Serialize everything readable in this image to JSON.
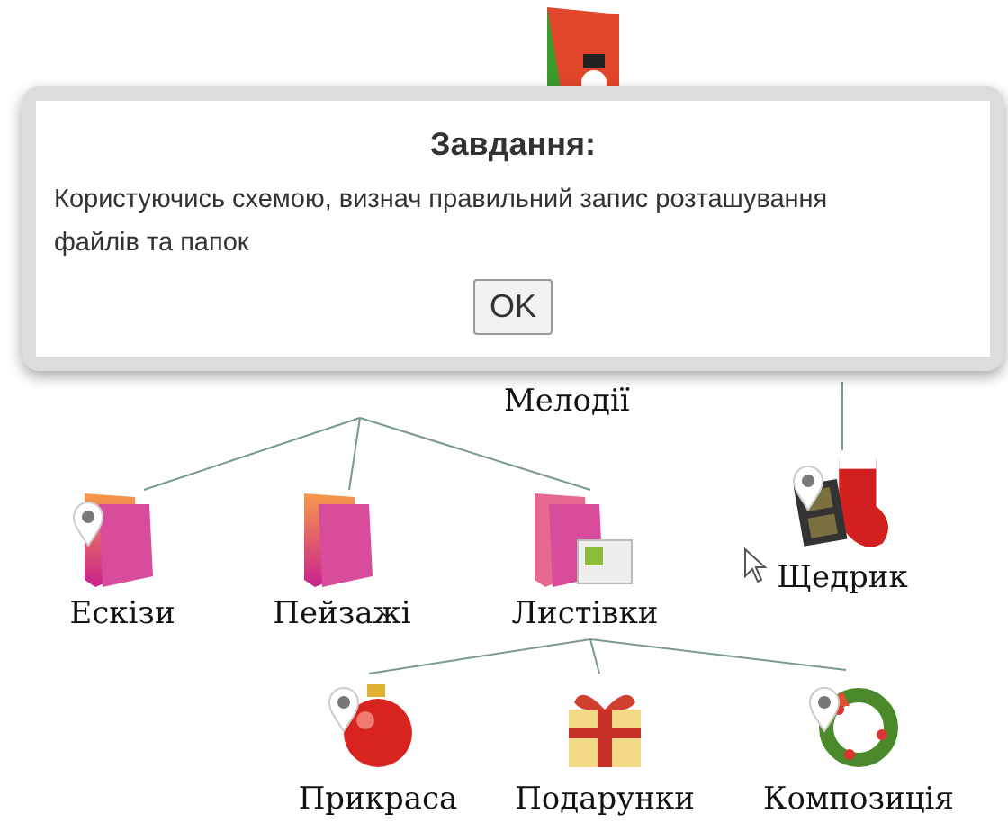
{
  "diagram": {
    "middle_label": "Мелодії",
    "nodes": [
      {
        "label": "Ескізи",
        "kind": "folder",
        "marked": true
      },
      {
        "label": "Пейзажі",
        "kind": "folder",
        "marked": false
      },
      {
        "label": "Щедрик",
        "kind": "video",
        "marked": true
      },
      {
        "label": "Листівки",
        "kind": "folder-cards",
        "marked": false,
        "children": [
          {
            "label": "Прикраса",
            "kind": "ornament",
            "marked": true
          },
          {
            "label": "Подарунки",
            "kind": "gift",
            "marked": false
          },
          {
            "label": "Композиція",
            "kind": "wreath",
            "marked": true
          }
        ]
      }
    ]
  },
  "dialog": {
    "title": "Завдання:",
    "message": "Користуючись схемою, визнач правильний запис розташування файлів та папок",
    "button": "OK"
  }
}
